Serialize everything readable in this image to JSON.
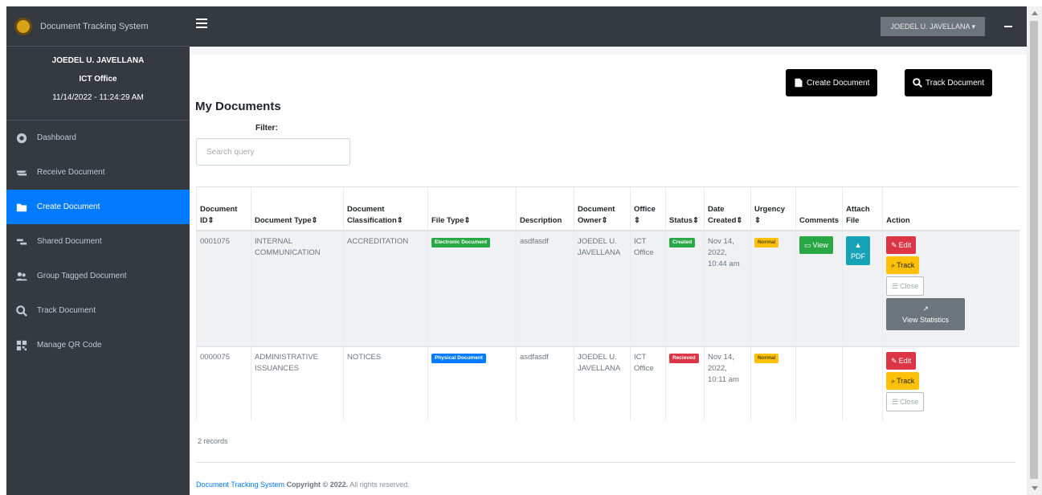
{
  "brand": {
    "title": "Document Tracking System"
  },
  "user": {
    "name": "JOEDEL U. JAVELLANA",
    "office": "ICT Office",
    "datetime": "11/14/2022 - 11:24:29 AM"
  },
  "nav": [
    {
      "label": "Dashboard",
      "icon": "dashboard-icon",
      "active": false
    },
    {
      "label": "Receive Document",
      "icon": "receive-icon",
      "active": false
    },
    {
      "label": "Create Document",
      "icon": "folder-plus-icon",
      "active": true
    },
    {
      "label": "Shared Document",
      "icon": "share-icon",
      "active": false
    },
    {
      "label": "Group Tagged Document",
      "icon": "group-icon",
      "active": false
    },
    {
      "label": "Track Document",
      "icon": "search-icon",
      "active": false
    },
    {
      "label": "Manage QR Code",
      "icon": "qr-icon",
      "active": false
    }
  ],
  "topbar": {
    "user_dropdown": "JOEDEL U. JAVELLANA ▾"
  },
  "actions": {
    "create": "Create Document",
    "track": "Track Document"
  },
  "page": {
    "title": "My Documents",
    "filter_label": "Filter:",
    "search_placeholder": "Search query"
  },
  "table": {
    "headers": {
      "doc_id": "Document ID⇕",
      "doc_type": "Document Type⇕",
      "classification": "Document Classification⇕",
      "file_type": "File Type⇕",
      "description": "Description",
      "owner": "Document Owner⇕",
      "office": "Office ⇕",
      "status": "Status⇕",
      "date": "Date Created⇕",
      "urgency": "Urgency ⇕",
      "comments": "Comments",
      "attach": "Attach File",
      "action": "Action"
    },
    "rows": [
      {
        "doc_id": "0001075",
        "doc_type": "INTERNAL COMMUNICATION",
        "classification": "ACCREDITATION",
        "file_type": "Electronic Document",
        "description": "asdfasdf",
        "owner": "JOEDEL U. JAVELLANA",
        "office": "ICT Office",
        "status": "Created",
        "date": "Nov 14, 2022, 10:44 am",
        "urgency": "Normal",
        "comments_btn": "View",
        "attach_btn": "PDF",
        "edit": "Edit",
        "track": "Track",
        "close": "Close",
        "stats": "View Statistics"
      },
      {
        "doc_id": "0000075",
        "doc_type": "ADMINISTRATIVE ISSUANCES",
        "classification": "NOTICES",
        "file_type": "Physical Document",
        "description": "asdfasdf",
        "owner": "JOEDEL U. JAVELLANA",
        "office": "ICT Office",
        "status": "Recieved",
        "date": "Nov 14, 2022, 10:11 am",
        "urgency": "Normal",
        "edit": "Edit",
        "track": "Track",
        "close": "Close"
      }
    ]
  },
  "records": "2 records",
  "footer": {
    "link": "Document Tracking System",
    "copyright": "Copyright © 2022.",
    "rights": "All rights reserved."
  },
  "colors": {
    "sidebar": "#343a40",
    "active": "#007bff",
    "success": "#28a745",
    "danger": "#dc3545",
    "warning": "#ffc107",
    "info": "#17a2b8"
  }
}
